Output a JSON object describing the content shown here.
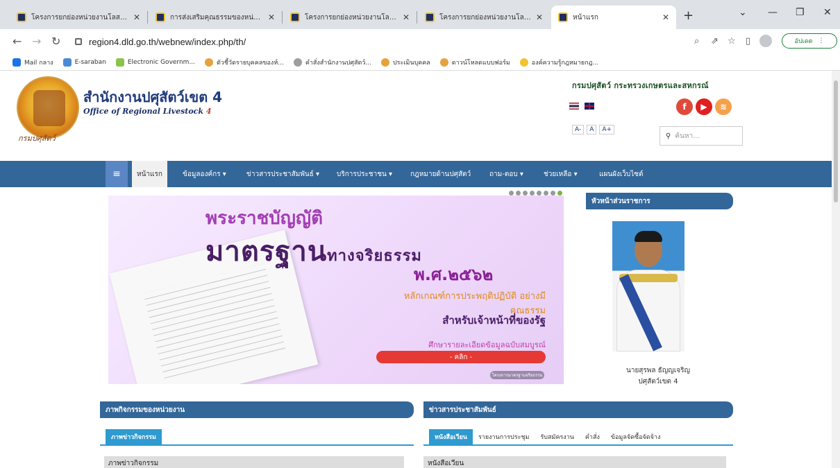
{
  "browser": {
    "tabs": [
      {
        "title": "โครงการยกย่องหน่วยงานโลสสอาด"
      },
      {
        "title": "การส่งเสริมคุณธรรมของหน่วยงาน"
      },
      {
        "title": "โครงการยกย่องหน่วยงานโลสสอาด"
      },
      {
        "title": "โครงการยกย่องหน่วยงานโลสสอาด"
      },
      {
        "title": "หน้าแรก"
      }
    ],
    "url": "region4.dld.go.th/webnew/index.php/th/",
    "update_label": "อัปเดต",
    "bookmarks": [
      {
        "label": "Mail กลาง",
        "color": "#1a73e8"
      },
      {
        "label": "E-saraban",
        "color": "#4a8bd4"
      },
      {
        "label": "Electronic Governm...",
        "color": "#8bc34a"
      },
      {
        "label": "ตัวชี้วัดรายบุคคลของห์...",
        "color": "#e6a23c"
      },
      {
        "label": "คำสั่งสำนักงานปศุสัตว์...",
        "color": "#9e9e9e"
      },
      {
        "label": "ประเมินบุคคล",
        "color": "#e6a23c"
      },
      {
        "label": "ดาวน์โหลดแบบฟอร์ม",
        "color": "#e6a23c"
      },
      {
        "label": "องค์ความรู้กฎหมายกฎ...",
        "color": "#f2c230"
      }
    ]
  },
  "header": {
    "title_th": "สำนักงานปศุสัตว์เขต 4",
    "title_en_prefix": "Office of Regional Livestock",
    "title_en_num": "4",
    "logo_caption": "กรมปศุสัตว์",
    "dept_line": "กรมปศุสัตว์ กระทรวงเกษตรและสหกรณ์",
    "font_sizes": [
      "A-",
      "A",
      "A+"
    ],
    "search_placeholder": "ค้นหา..."
  },
  "nav": {
    "items": [
      {
        "label": "หน้าแรก"
      },
      {
        "label": "ข้อมูลองค์กร ▾"
      },
      {
        "label": "ข่าวสารประชาสัมพันธ์ ▾"
      },
      {
        "label": "บริการประชาชน ▾"
      },
      {
        "label": "กฎหมายด้านปศุสัตว์"
      },
      {
        "label": "ถาม-ตอบ ▾"
      },
      {
        "label": "ช่วยเหลือ ▾"
      },
      {
        "label": "แผนผังเว็บไซต์"
      }
    ]
  },
  "banner": {
    "line1": "พระราชบัญญัติ",
    "line2_big": "มาตรฐาน",
    "line2_small": "ทางจริยธรรม",
    "line3": "พ.ศ.๒๕๖๒",
    "line4": "หลักเกณฑ์การประพฤติปฏิบัติ อย่างมีคุณธรรม",
    "line5": "สำหรับเจ้าหน้าที่ของรัฐ",
    "line6": "ศึกษารายละเอียดข้อมูลฉบับสมบูรณ์",
    "button": "- คลิก -",
    "tag": "โครงการมาตรฐานจริยธรรม"
  },
  "sidebar": {
    "heading": "หัวหน้าส่วนราชการ",
    "name": "นายสุรพล ธัญญเจริญ",
    "role": "ปศุสัตว์เขต 4"
  },
  "activities": {
    "heading": "ภาพกิจกรรมของหน่วยงาน",
    "tab": "ภาพข่าวกิจกรรม",
    "row": "ภาพข่าวกิจกรรม"
  },
  "news": {
    "heading": "ข่าวสารประชาสัมพันธ์",
    "tabs": [
      "หนังสือเวียน",
      "รายงานการประชุม",
      "รับสมัครงาน",
      "คำสั่ง",
      "ข้อมูลจัดซื้อจัดจ้าง"
    ],
    "row": "หนังสือเวียน"
  },
  "colors": {
    "nav_blue": "#336699",
    "tab_blue": "#2e9ad0"
  }
}
